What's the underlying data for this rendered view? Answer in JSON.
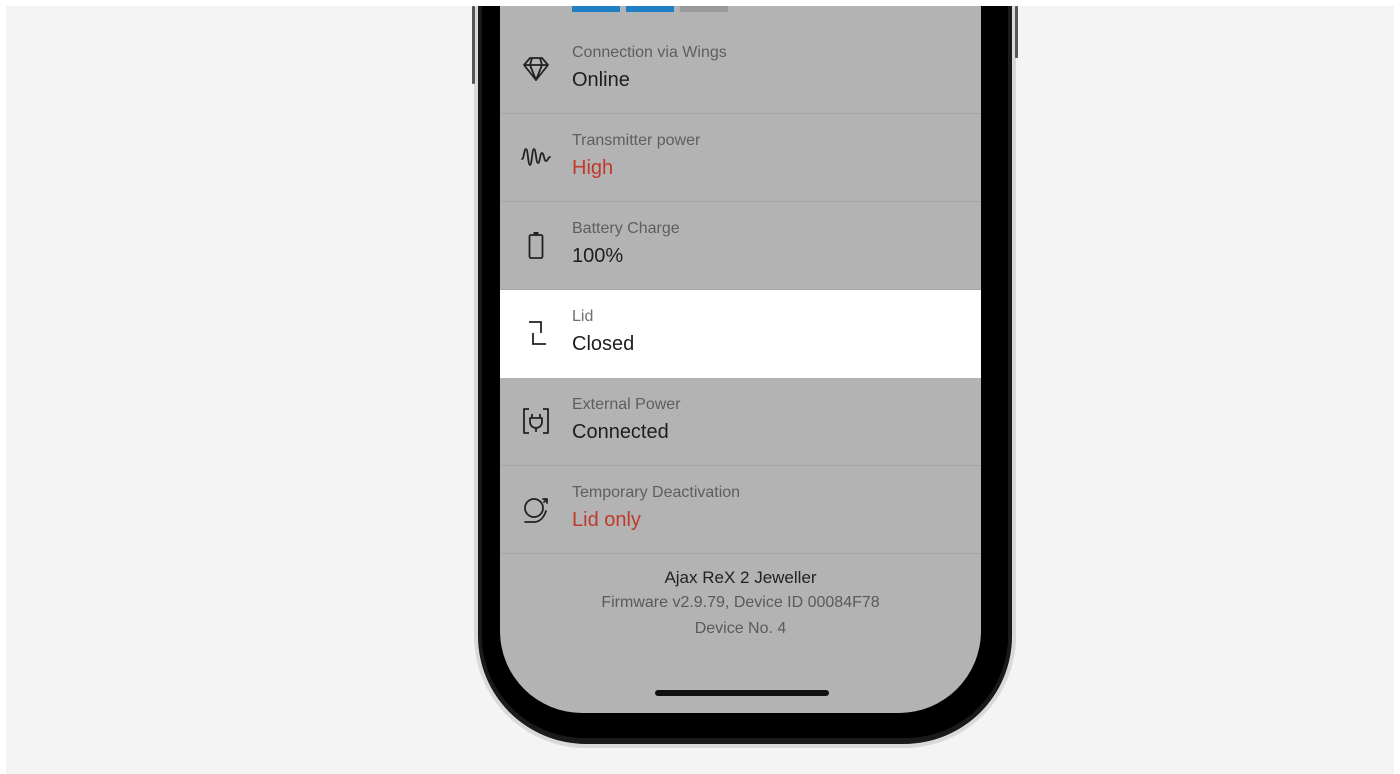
{
  "status_bar_segments": [
    {
      "name": "segment-1",
      "color": "#1f7fc4"
    },
    {
      "name": "segment-2",
      "color": "#1f7fc4"
    },
    {
      "name": "segment-3",
      "color": "#9a9a9a"
    }
  ],
  "rows": [
    {
      "id": "connection",
      "icon": "wings-icon",
      "label": "Connection via Wings",
      "value": "Online",
      "value_color": "normal"
    },
    {
      "id": "transmitter-power",
      "icon": "signal-wave-icon",
      "label": "Transmitter power",
      "value": "High",
      "value_color": "warn"
    },
    {
      "id": "battery",
      "icon": "battery-icon",
      "label": "Battery Charge",
      "value": "100%",
      "value_color": "normal"
    },
    {
      "id": "lid",
      "icon": "lid-icon",
      "label": "Lid",
      "value": "Closed",
      "value_color": "normal",
      "highlighted": true
    },
    {
      "id": "external-power",
      "icon": "power-plug-icon",
      "label": "External Power",
      "value": "Connected",
      "value_color": "normal"
    },
    {
      "id": "temporary-deactivation",
      "icon": "deactivation-icon",
      "label": "Temporary Deactivation",
      "value": "Lid only",
      "value_color": "warn"
    }
  ],
  "footer": {
    "device_name": "Ajax ReX 2 Jeweller",
    "firmware": "Firmware v2.9.79, Device ID 00084F78",
    "device_no": "Device No. 4"
  },
  "colors": {
    "warn": "#c0392b",
    "screen_dim": "#b3b3b3",
    "highlight": "#ffffff",
    "accent": "#1f7fc4"
  }
}
